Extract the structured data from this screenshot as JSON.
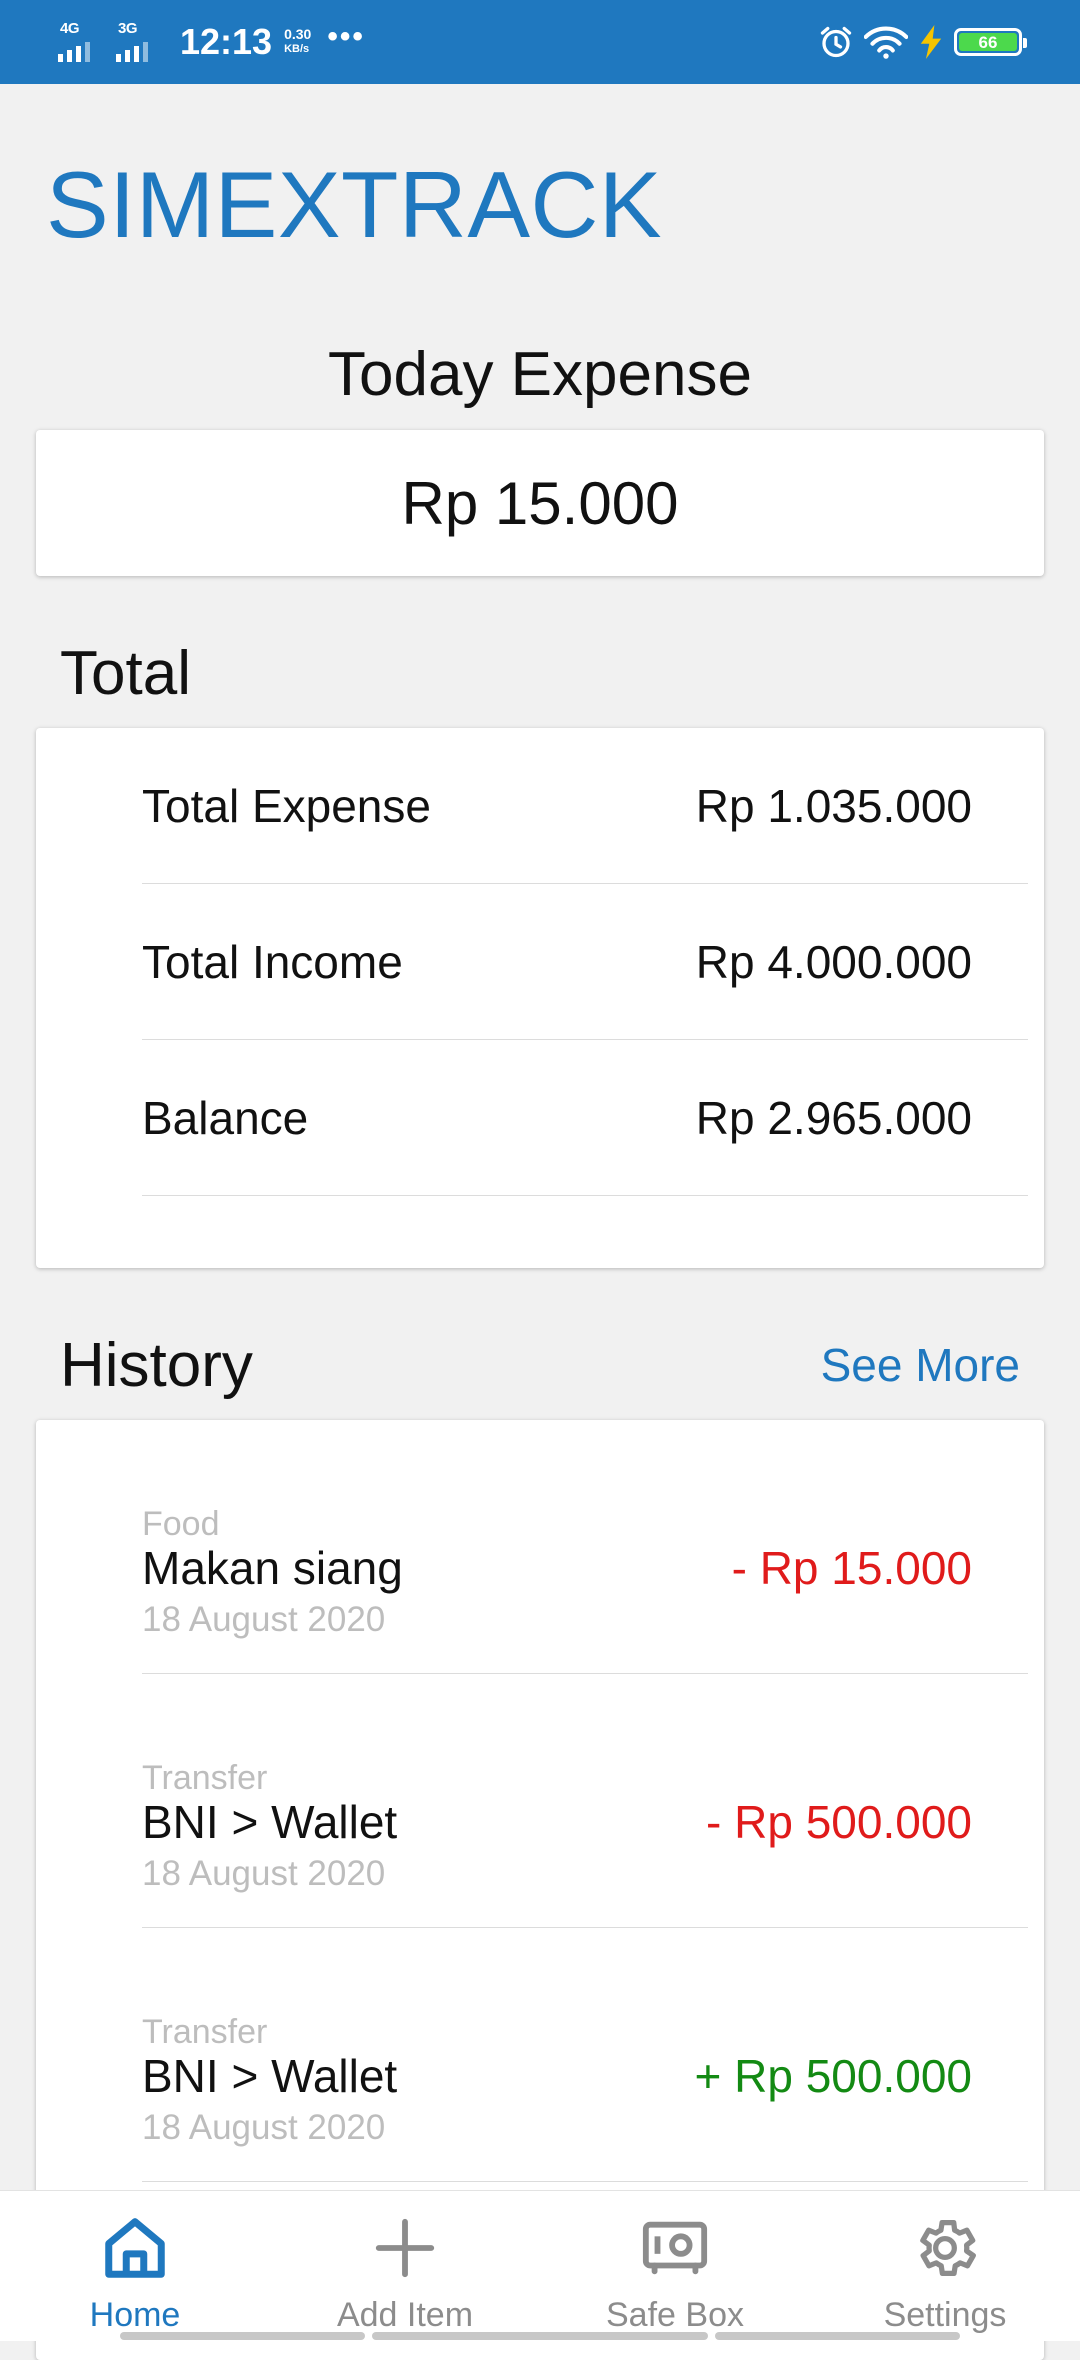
{
  "status_bar": {
    "network1": "4G",
    "network2": "3G",
    "time": "12:13",
    "speed_value": "0.30",
    "speed_unit": "KB/s",
    "more": "•••",
    "battery_level": "66"
  },
  "app": {
    "title": "SIMEXTRACK"
  },
  "today": {
    "heading": "Today Expense",
    "amount": "Rp 15.000"
  },
  "total": {
    "heading": "Total",
    "rows": [
      {
        "label": "Total Expense",
        "value": "Rp 1.035.000"
      },
      {
        "label": "Total Income",
        "value": "Rp 4.000.000"
      },
      {
        "label": "Balance",
        "value": "Rp 2.965.000"
      }
    ]
  },
  "history": {
    "heading": "History",
    "see_more": "See More",
    "items": [
      {
        "category": "Food",
        "name": "Makan siang",
        "date": "18 August 2020",
        "amount": "- Rp 15.000",
        "type": "expense"
      },
      {
        "category": "Transfer",
        "name": "BNI > Wallet",
        "date": "18 August 2020",
        "amount": "- Rp 500.000",
        "type": "expense"
      },
      {
        "category": "Transfer",
        "name": "BNI > Wallet",
        "date": "18 August 2020",
        "amount": "+ Rp 500.000",
        "type": "income"
      }
    ]
  },
  "nav": {
    "items": [
      {
        "label": "Home",
        "icon": "home-icon",
        "active": true
      },
      {
        "label": "Add Item",
        "icon": "plus-icon",
        "active": false
      },
      {
        "label": "Safe Box",
        "icon": "safe-box-icon",
        "active": false
      },
      {
        "label": "Settings",
        "icon": "gear-icon",
        "active": false
      }
    ]
  },
  "colors": {
    "accent": "#1f78bf",
    "expense": "#e01b1b",
    "income": "#138a13",
    "muted": "#bdbdbd"
  }
}
